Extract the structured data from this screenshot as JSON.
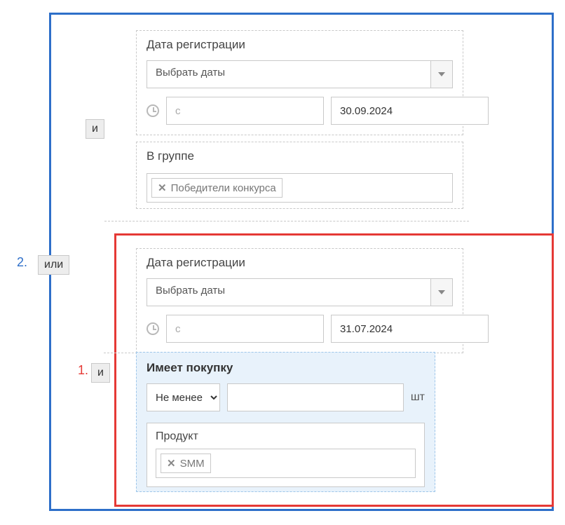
{
  "connectors": {
    "and": "и",
    "or": "или"
  },
  "callouts": {
    "n1": "1.",
    "n2": "2."
  },
  "block1": {
    "regdate": {
      "title": "Дата регистрации",
      "select_label": "Выбрать даты",
      "from_placeholder": "с",
      "to_value": "30.09.2024"
    },
    "group": {
      "title": "В группе",
      "chip": "Победители конкурса"
    }
  },
  "block2": {
    "regdate": {
      "title": "Дата регистрации",
      "select_label": "Выбрать даты",
      "from_placeholder": "с",
      "to_value": "31.07.2024"
    },
    "purchase": {
      "title": "Имеет покупку",
      "op_selected": "Не менее",
      "qty_value": "",
      "unit": "шт",
      "product": {
        "title": "Продукт",
        "chip": "SMM"
      }
    }
  }
}
